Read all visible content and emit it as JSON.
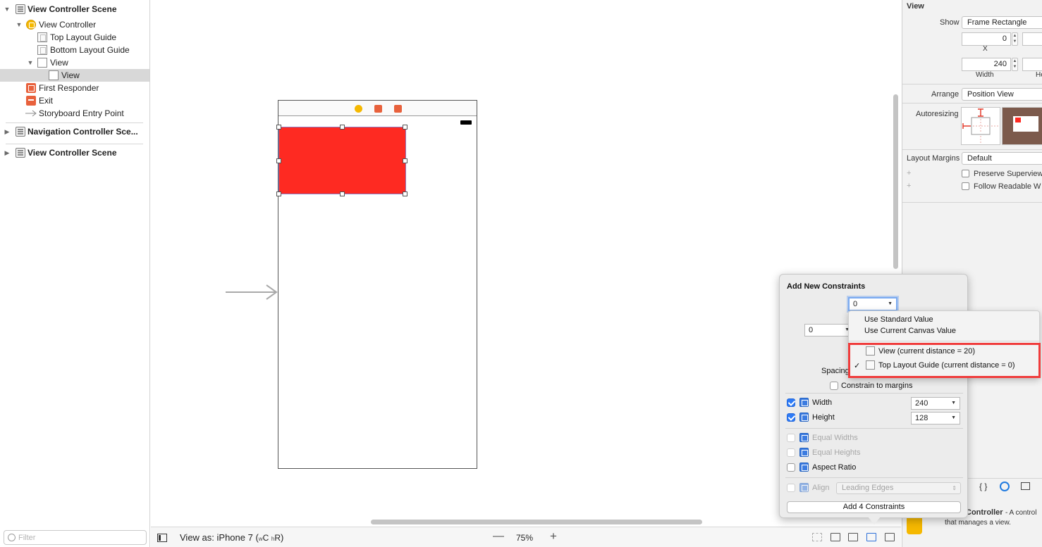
{
  "outline": {
    "items": [
      {
        "label": "View Controller Scene",
        "bold": true
      },
      {
        "label": "View Controller"
      },
      {
        "label": "Top Layout Guide"
      },
      {
        "label": "Bottom Layout Guide"
      },
      {
        "label": "View"
      },
      {
        "label": "View"
      },
      {
        "label": "First Responder"
      },
      {
        "label": "Exit"
      },
      {
        "label": "Storyboard Entry Point"
      },
      {
        "label": "Navigation Controller Sce...",
        "bold": true
      },
      {
        "label": "View Controller Scene",
        "bold": true
      }
    ],
    "filter_placeholder": "Filter"
  },
  "bottom_bar": {
    "view_as_prefix": "View as: iPhone 7 (",
    "w": "w",
    "c": "C",
    "h": "h",
    "r": "R",
    "close": ")",
    "zoom_minus": "—",
    "zoom": "75%",
    "zoom_plus": "+"
  },
  "inspector": {
    "section": "View",
    "show_label": "Show",
    "show_value": "Frame Rectangle",
    "x_value": "0",
    "x_label": "X",
    "width_value": "240",
    "width_label": "Width",
    "height_label_partial": "He",
    "arrange_label": "Arrange",
    "arrange_value": "Position View",
    "autoresizing_label": "Autoresizing",
    "layout_margins_label": "Layout Margins",
    "layout_margins_value": "Default",
    "preserve_label": "Preserve Superview",
    "follow_label": "Follow Readable W",
    "plus": "+",
    "lib_braces": "{ }",
    "controller_title": "Controller",
    "controller_desc_1": " - A control",
    "controller_desc_2": "that manages a view."
  },
  "constraints": {
    "title": "Add New Constraints",
    "top_value": "0",
    "left_value": "0",
    "spacing_label": "Spacing",
    "constrain_margins": "Constrain to margins",
    "width_label": "Width",
    "width_value": "240",
    "height_label": "Height",
    "height_value": "128",
    "equal_widths": "Equal Widths",
    "equal_heights": "Equal Heights",
    "aspect_ratio": "Aspect Ratio",
    "align_label": "Align",
    "align_value": "Leading Edges",
    "add_button": "Add 4 Constraints",
    "width_checked": true,
    "height_checked": true,
    "aspect_checked": false
  },
  "menu": {
    "use_standard": "Use Standard Value",
    "use_current": "Use Current Canvas Value",
    "view_option": "View (current distance = 20)",
    "top_guide_option": "Top Layout Guide (current distance = 0)",
    "checkmark": "✓"
  },
  "colors": {
    "selected_view_fill": "#fe2a22",
    "highlight_border": "#f03c3c",
    "checkbox_on": "#2e7bf6"
  }
}
